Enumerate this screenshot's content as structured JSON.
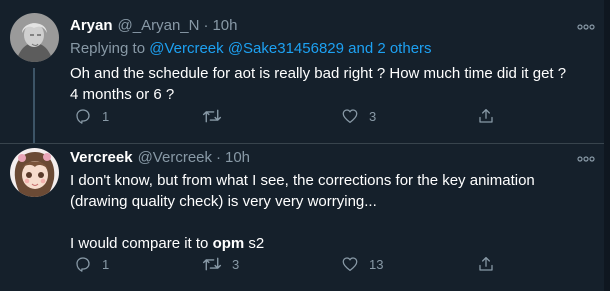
{
  "tweets": [
    {
      "author_name": "Aryan",
      "handle": "@_Aryan_N",
      "separator": "·",
      "time": "10h",
      "replying_prefix": "Replying to ",
      "replying_mention_1": "@Vercreek",
      "replying_mention_2": "@Sake31456829",
      "replying_others": "and 2 others",
      "text_line_1": "Oh and the schedule for aot is really bad right ? How much time did it get ?",
      "text_line_2": "4 months or 6 ?",
      "reply_count": "1",
      "retweet_count": "",
      "like_count": "3"
    },
    {
      "author_name": "Vercreek",
      "handle": "@Vercreek",
      "separator": "·",
      "time": "10h",
      "text_line_1": "I don't know, but from what I see, the corrections for the key animation",
      "text_line_2": "(drawing quality check) is very very worrying...",
      "text_line_3_prefix": "I would compare it to ",
      "text_line_3_bold": "opm",
      "text_line_3_suffix": " s2",
      "reply_count": "1",
      "retweet_count": "3",
      "like_count": "13"
    }
  ],
  "colors": {
    "background": "#15202b",
    "secondary_text": "#8899a6",
    "link": "#1da1f2",
    "divider": "#38444d"
  },
  "icons": [
    "more-icon",
    "reply-icon",
    "retweet-icon",
    "like-icon",
    "share-icon"
  ]
}
